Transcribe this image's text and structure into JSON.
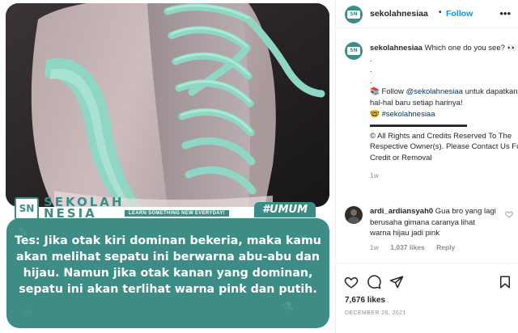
{
  "colors": {
    "brand_teal": "#3d8c86",
    "link_blue": "#0095f6",
    "muted_gray": "#8e8e8e",
    "shoe_pink": "#c9b6b6",
    "shoe_mint": "#8fd6c4"
  },
  "post_image": {
    "brand_logo_initials": "SN",
    "brand_line_1": "SEKOLAH",
    "brand_line_2": "NESIA",
    "tagline": "LEARN SOMETHING NEW EVERYDAY!",
    "hashtag_badge": "#UMUM",
    "caption": "Tes: Jika otak kiri dominan bekeria, maka kamu akan melihat sepatu ini berwarna abu-abu dan hijau. Namun jika otak kanan yang dominan, sepatu ini akan terlihat warna pink dan putih."
  },
  "header": {
    "avatar_text": "SN",
    "username": "sekolahnesiaa",
    "separator": "•",
    "follow_label": "Follow",
    "more_icon": "more-horizontal-icon"
  },
  "caption": {
    "username": "sekolahnesiaa",
    "line_1": "Which one do you see? 👀",
    "dot_1": ".",
    "dot_2": ".",
    "dot_3": ".",
    "follow_prefix": "📚 Follow ",
    "follow_handle": "@sekolahnesiaa",
    "follow_suffix": " untuk dapatkan hal-hal baru setiap harinya!",
    "hashtag_prefix": "🤓 ",
    "hashtag": "#sekolahnesiaa",
    "divider": "▬▬▬▬▬▬▬▬▬▬▬▬▬▬",
    "credits": "© All Rights and Credits Reserved To The Respective Owner(s). Please Contact Us For Credit or Removal",
    "time": "1w"
  },
  "comment": {
    "username": "ardi_ardiansyah0",
    "text": "Gua bro yang lagi berusaha gimana caranya lihat warna hijau jadi pink",
    "time": "1w",
    "likes": "1,037 likes",
    "reply_label": "Reply",
    "like_icon": "heart-outline-icon"
  },
  "actions": {
    "like_icon": "heart-icon",
    "comment_icon": "comment-icon",
    "share_icon": "send-icon",
    "save_icon": "bookmark-icon",
    "likes_count": "7,676 likes",
    "date": "DECEMBER 26, 2021"
  }
}
